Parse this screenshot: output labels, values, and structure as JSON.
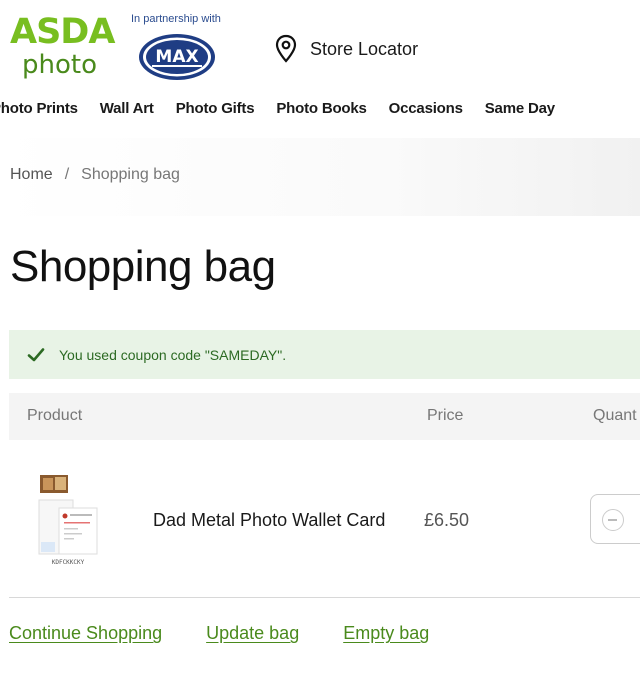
{
  "brand": {
    "logo_top": "ASDA",
    "logo_bottom": "photo",
    "partnership_text": "In partnership with",
    "partner_logo_text": "MAX",
    "primary_color": "#78be20",
    "dark_green": "#4a8a1c"
  },
  "header": {
    "store_locator_label": "Store Locator",
    "store_locator_icon": "map-pin-icon"
  },
  "nav": {
    "items": [
      {
        "label": "Photo Prints"
      },
      {
        "label": "Wall Art"
      },
      {
        "label": "Photo Gifts"
      },
      {
        "label": "Photo Books"
      },
      {
        "label": "Occasions"
      },
      {
        "label": "Same Day"
      }
    ]
  },
  "breadcrumb": {
    "home": "Home",
    "separator": "/",
    "current": "Shopping bag"
  },
  "page": {
    "title": "Shopping bag"
  },
  "notice": {
    "icon": "check-icon",
    "text": "You used coupon code \"SAMEDAY\".",
    "background": "#e8f3e6",
    "text_color": "#2c6a23"
  },
  "table": {
    "headers": {
      "product": "Product",
      "price": "Price",
      "quantity": "Quant"
    },
    "rows": [
      {
        "name": "Dad Metal Photo Wallet Card",
        "price": "£6.50",
        "thumb_caption": "KDFCKKCKY"
      }
    ]
  },
  "actions": {
    "continue": "Continue Shopping",
    "update": "Update bag",
    "empty": "Empty bag"
  }
}
